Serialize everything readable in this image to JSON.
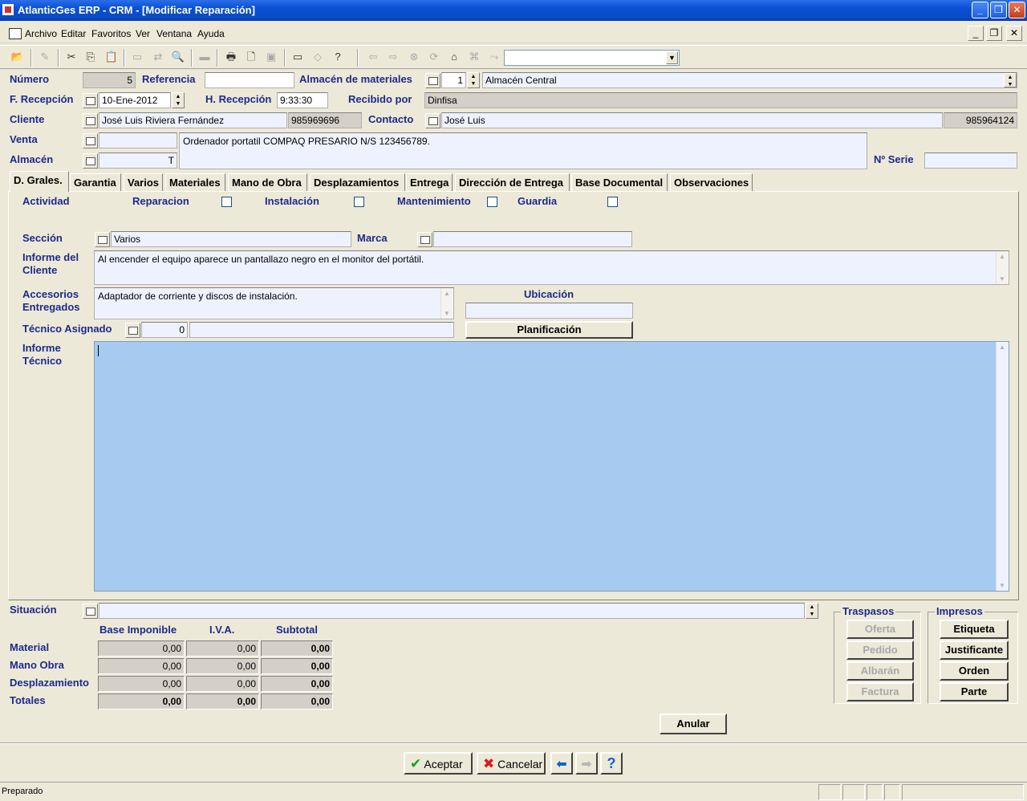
{
  "window": {
    "title": "AtlanticGes ERP - CRM - [Modificar Reparación]"
  },
  "menu": [
    "Archivo",
    "Editar",
    "Favoritos",
    "Ver",
    "Ventana",
    "Ayuda"
  ],
  "toolbar": {
    "combo_value": ""
  },
  "header": {
    "numero_label": "Número",
    "numero_value": "5",
    "referencia_label": "Referencia",
    "referencia_value": "",
    "almacen_mat_label": "Almacén de materiales",
    "almacen_mat_num": "1",
    "almacen_mat_value": "Almacén Central",
    "frecepcion_label": "F. Recepción",
    "frecepcion_value": "10-Ene-2012",
    "hrecepcion_label": "H. Recepción",
    "hrecepcion_value": "9:33:30",
    "recibido_label": "Recibido por",
    "recibido_value": "Dinfisa",
    "cliente_label": "Cliente",
    "cliente_value": "José Luis Riviera Fernández",
    "cliente_phone": "985969696",
    "contacto_label": "Contacto",
    "contacto_value": "José Luis",
    "contacto_phone": "985964124",
    "venta_label": "Venta",
    "venta_value": "",
    "almacen_label": "Almacén",
    "almacen_value": "T",
    "descripcion": "Ordenador portatil COMPAQ PRESARIO N/S 123456789.",
    "serie_label": "Nº Serie",
    "serie_value": ""
  },
  "tabs": [
    "D. Grales.",
    "Garantia",
    "Varios",
    "Materiales",
    "Mano de Obra",
    "Desplazamientos",
    "Entrega",
    "Dirección de Entrega",
    "Base Documental",
    "Observaciones"
  ],
  "general": {
    "actividad_label": "Actividad",
    "reparacion_label": "Reparacion",
    "instalacion_label": "Instalación",
    "mantenimiento_label": "Mantenimiento",
    "guardia_label": "Guardia",
    "seccion_label": "Sección",
    "seccion_value": "Varios",
    "marca_label": "Marca",
    "marca_value": "",
    "informe_cliente_label": "Informe del Cliente",
    "informe_cliente_value": "Al encender el equipo aparece un pantallazo negro en el monitor del portátil.",
    "accesorios_label": "Accesorios Entregados",
    "accesorios_value": "Adaptador de corriente y discos de instalación.",
    "ubicacion_label": "Ubicación",
    "ubicacion_value": "",
    "tecnico_label": "Técnico Asignado",
    "tecnico_num": "0",
    "tecnico_value": "",
    "planificacion_label": "Planificación",
    "informe_tecnico_label": "Informe Técnico",
    "informe_tecnico_value": ""
  },
  "situacion": {
    "label": "Situación",
    "value": ""
  },
  "totals": {
    "headers": [
      "Base Imponible",
      "I.V.A.",
      "Subtotal"
    ],
    "rows": [
      {
        "label": "Material",
        "values": [
          "0,00",
          "0,00",
          "0,00"
        ]
      },
      {
        "label": "Mano Obra",
        "values": [
          "0,00",
          "0,00",
          "0,00"
        ]
      },
      {
        "label": "Desplazamiento",
        "values": [
          "0,00",
          "0,00",
          "0,00"
        ]
      },
      {
        "label": "Totales",
        "values": [
          "0,00",
          "0,00",
          "0,00"
        ]
      }
    ]
  },
  "traspasos": {
    "title": "Traspasos",
    "buttons": [
      "Oferta",
      "Pedido",
      "Albarán",
      "Factura"
    ]
  },
  "impresos": {
    "title": "Impresos",
    "buttons": [
      "Etiqueta",
      "Justificante",
      "Orden",
      "Parte"
    ]
  },
  "anular_label": "Anular",
  "bottom": {
    "aceptar": "Aceptar",
    "cancelar": "Cancelar"
  },
  "status": "Preparado",
  "colors": {
    "title_bar": "#0A4FD4",
    "label": "#1E2A8A",
    "informe_bg": "#A6CAF0"
  }
}
